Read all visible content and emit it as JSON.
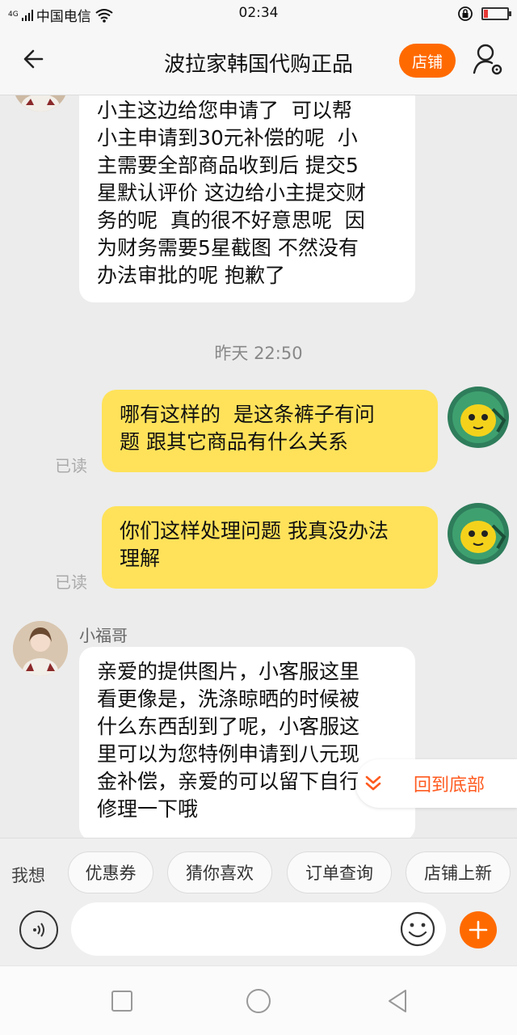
{
  "status_bar": {
    "network": "4G",
    "carrier": "中国电信",
    "time": "02:34",
    "battery_level": 0.1
  },
  "header": {
    "title": "波拉家韩国代购正品",
    "shop_button": "店铺",
    "back_icon": "back-arrow-icon",
    "user_icon": "user-settings-icon"
  },
  "messages": [
    {
      "side": "left",
      "text": "小主这边给您申请了  可以帮\n小主申请到30元补偿的呢  小\n主需要全部商品收到后 提交5\n星默认评价 这边给小主提交财\n务的呢  真的很不好意思呢  因\n为财务需要5星截图 不然没有\n办法审批的呢 抱歉了"
    },
    {
      "type": "timestamp",
      "text": "昨天  22:50"
    },
    {
      "side": "right",
      "text": "哪有这样的  是这条裤子有问\n题 跟其它商品有什么关系",
      "read": "已读"
    },
    {
      "side": "right",
      "text": "你们这样处理问题 我真没办法\n理解",
      "read": "已读"
    },
    {
      "side": "left",
      "sender": "小福哥",
      "text": "亲爱的提供图片，小客服这里\n看更像是，洗涤晾晒的时候被\n什么东西刮到了呢，小客服这\n里可以为您特例申请到八元现\n金补偿，亲爱的可以留下自行\n修理一下哦"
    }
  ],
  "back_to_bottom": "回到底部",
  "quick_bar": {
    "label": "我想",
    "chips": [
      "优惠券",
      "猜你喜欢",
      "订单查询",
      "店铺上新"
    ]
  },
  "input": {
    "placeholder": "",
    "accent_color": "#ff6a00"
  },
  "colors": {
    "accent": "#ff6a00",
    "own_bubble": "#ffe25a",
    "other_bubble": "#ffffff"
  }
}
